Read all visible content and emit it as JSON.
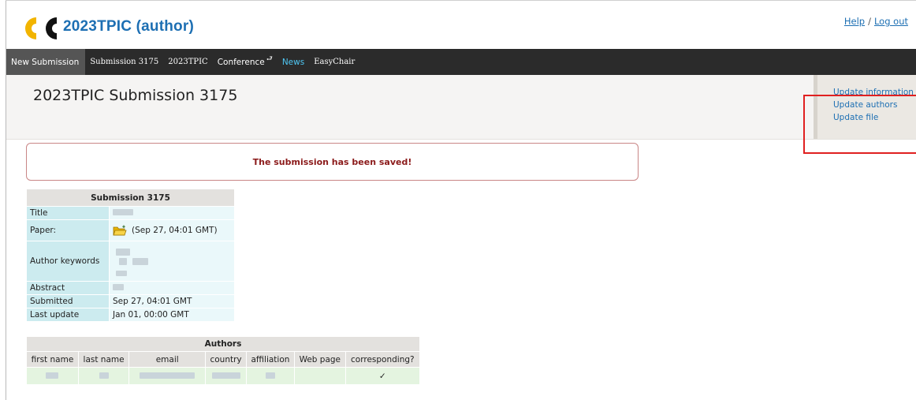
{
  "header": {
    "app_title": "2023TPIC (author)",
    "help_label": "Help",
    "separator": "/",
    "logout_label": "Log out"
  },
  "menu": {
    "items": [
      "New Submission",
      "Submission 3175",
      "2023TPIC",
      "Conference",
      "News",
      "EasyChair"
    ]
  },
  "page": {
    "title": "2023TPIC Submission 3175"
  },
  "side_panel": {
    "links": [
      "Update information",
      "Update authors",
      "Update file"
    ]
  },
  "message": "The submission has been saved!",
  "submission": {
    "caption": "Submission 3175",
    "rows": {
      "title_label": "Title",
      "paper_label": "Paper:",
      "paper_value": "(Sep 27, 04:01 GMT)",
      "keywords_label": "Author keywords",
      "abstract_label": "Abstract",
      "submitted_label": "Submitted",
      "submitted_value": "Sep 27, 04:01 GMT",
      "last_update_label": "Last update",
      "last_update_value": "Jan 01, 00:00 GMT"
    }
  },
  "authors": {
    "caption": "Authors",
    "columns": [
      "first name",
      "last name",
      "email",
      "country",
      "affiliation",
      "Web page",
      "corresponding?"
    ],
    "corresponding_mark": "✓"
  },
  "colors": {
    "brand_blue": "#1d6fb3",
    "menu_bg": "#2b2b2b",
    "news_accent": "#4fc8f5",
    "message_red": "#8b1a1a",
    "highlight_red": "#e02020"
  }
}
